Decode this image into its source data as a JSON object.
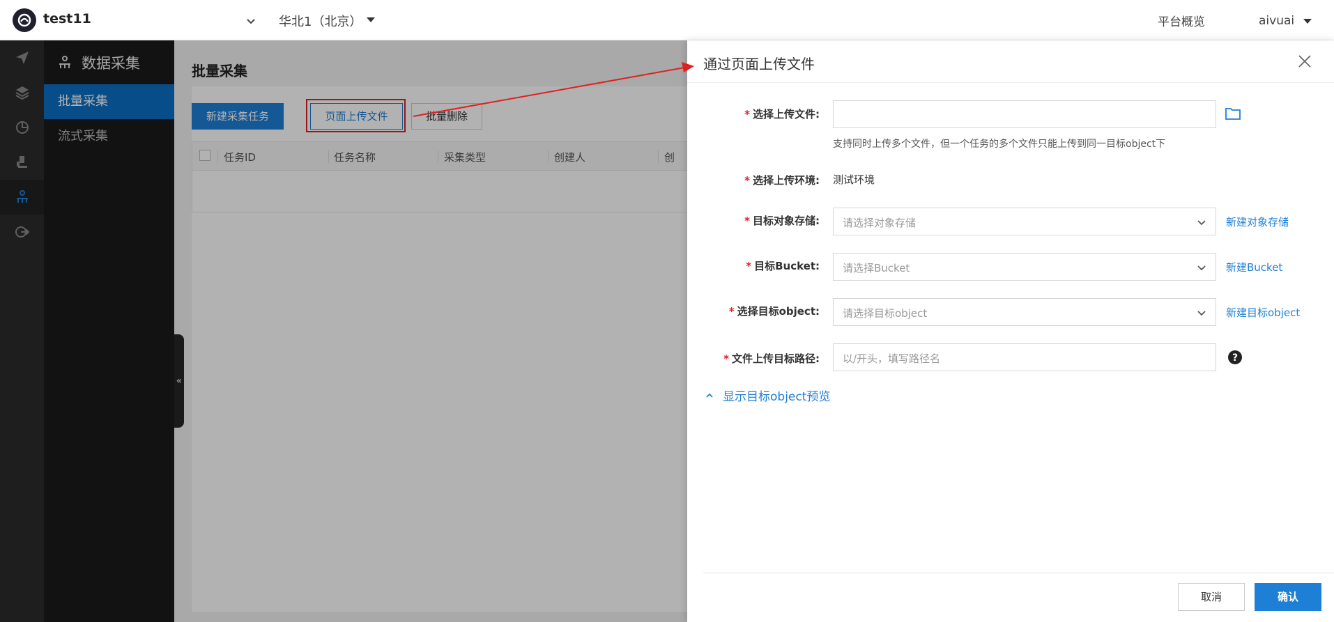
{
  "header": {
    "app_title": "test11",
    "region": "华北1（北京）",
    "platform_overview": "平台概览",
    "username": "aivuai"
  },
  "sidebar": {
    "section_title": "数据采集",
    "items": [
      {
        "label": "批量采集",
        "active": true
      },
      {
        "label": "流式采集",
        "active": false
      }
    ]
  },
  "main": {
    "page_title": "批量采集",
    "buttons": {
      "new_task": "新建采集任务",
      "upload_page": "页面上传文件",
      "batch_delete": "批量删除"
    },
    "table": {
      "columns": [
        "任务ID",
        "任务名称",
        "采集类型",
        "创建人",
        "创"
      ]
    }
  },
  "drawer": {
    "title": "通过页面上传文件",
    "select_file_label": "选择上传文件:",
    "select_file_help": "支持同时上传多个文件，但一个任务的多个文件只能上传到同一目标object下",
    "env_label": "选择上传环境:",
    "env_value": "测试环境",
    "storage_label": "目标对象存储:",
    "storage_placeholder": "请选择对象存储",
    "storage_link": "新建对象存储",
    "bucket_label": "目标Bucket:",
    "bucket_placeholder": "请选择Bucket",
    "bucket_link": "新建Bucket",
    "object_label": "选择目标object:",
    "object_placeholder": "请选择目标object",
    "object_link": "新建目标object",
    "path_label": "文件上传目标路径:",
    "path_placeholder": "以/开头，填写路径名",
    "preview_toggle": "显示目标object预览",
    "cancel": "取消",
    "confirm": "确认"
  },
  "colors": {
    "primary": "#1e7fd6",
    "annotation": "#e02020",
    "sidebar_active": "#0b6fc4",
    "sidebar_bg": "#1a1a1a"
  },
  "icons": [
    "logo-icon",
    "chevron-down-icon",
    "caret-down-icon",
    "send-icon",
    "layers-icon",
    "pie-chart-icon",
    "robot-icon",
    "data-collect-icon",
    "share-icon",
    "folder-icon",
    "help-icon",
    "close-icon",
    "chevron-up-icon",
    "double-chevron-left-icon"
  ]
}
